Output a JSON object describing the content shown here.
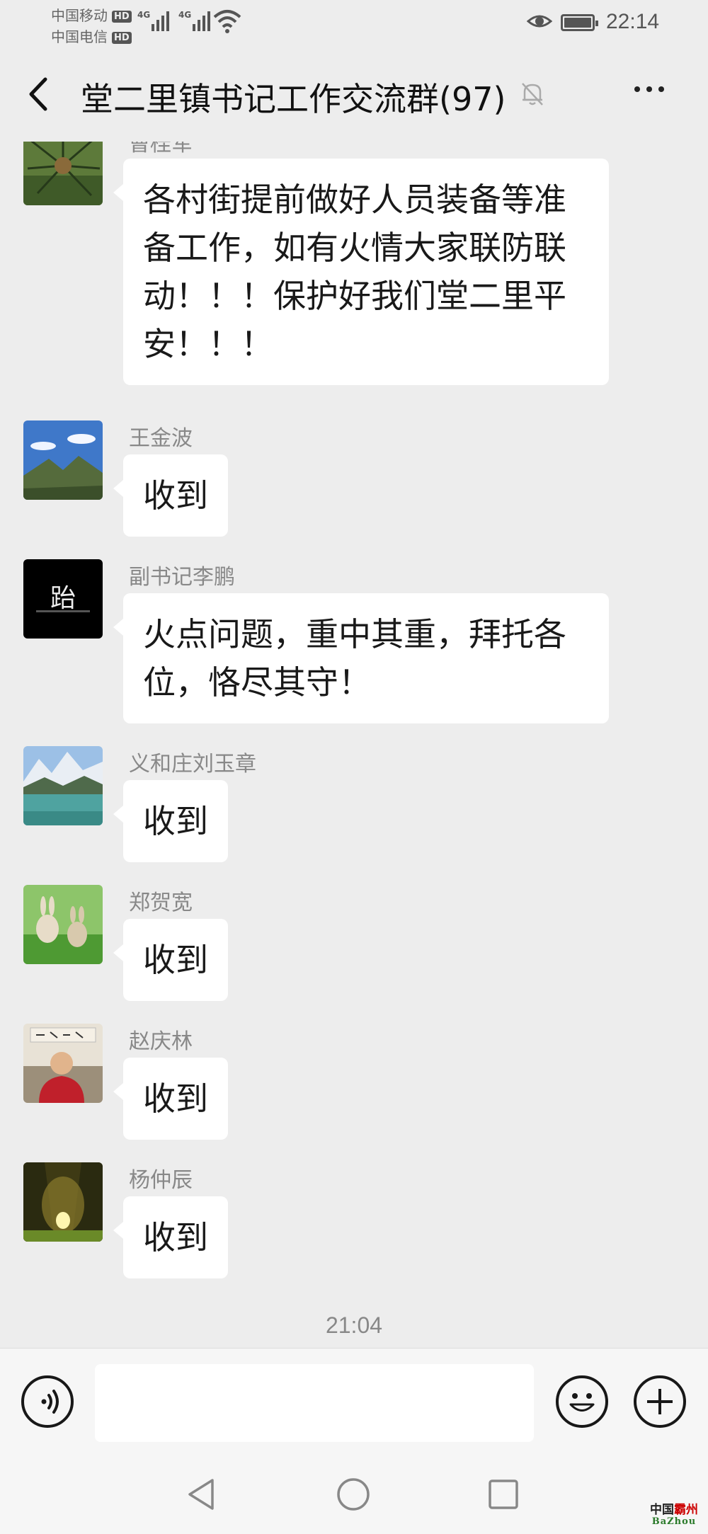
{
  "status_bar": {
    "carrier_1": "中国移动",
    "carrier_2": "中国电信",
    "hd_badge": "HD",
    "network_type": "4G",
    "time": "22:14"
  },
  "header": {
    "title": "堂二里镇书记工作交流群(97)",
    "back_icon": "chevron-left-icon",
    "mute_icon": "bell-muted-icon",
    "more_icon": "ellipsis-icon"
  },
  "messages": [
    {
      "sender": "曹桂军",
      "text": "各村街提前做好人员装备等准备工作，如有火情大家联防联动！！！保护好我们堂二里平安！！！",
      "lines": [
        "各村街提前做好人员装备等准",
        "备工作，如有火情大家联防联",
        "动！！！保护好我们堂二里平",
        "安！！！"
      ]
    },
    {
      "sender": "王金波",
      "text": "收到"
    },
    {
      "sender": "副书记李鹏",
      "text": "火点问题，重中其重，拜托各位，恪尽其守！",
      "lines": [
        "火点问题，重中其重，拜托各",
        "位，恪尽其守！"
      ]
    },
    {
      "sender": "义和庄刘玉章",
      "text": "收到"
    },
    {
      "sender": "郑贺宽",
      "text": "收到"
    },
    {
      "sender": "赵庆林",
      "text": "收到"
    },
    {
      "sender": "杨仲辰",
      "text": "收到"
    }
  ],
  "avatar_3_text": "跆",
  "time_separator": "21:04",
  "input_bar": {
    "voice_icon": "voice-icon",
    "emoji_icon": "emoji-icon",
    "plus_icon": "plus-icon",
    "message_input_value": ""
  },
  "nav_bar": {
    "back_icon": "triangle-back-icon",
    "home_icon": "circle-home-icon",
    "recent_icon": "square-recent-icon"
  },
  "watermark": {
    "line1_a": "中国",
    "line1_b": "霸州",
    "line2": "BaZhou"
  },
  "colors": {
    "background": "#ededed",
    "bubble": "#ffffff",
    "sender_name": "#888888",
    "watermark_red": "#cc0000",
    "watermark_green": "#2a7a2a"
  }
}
